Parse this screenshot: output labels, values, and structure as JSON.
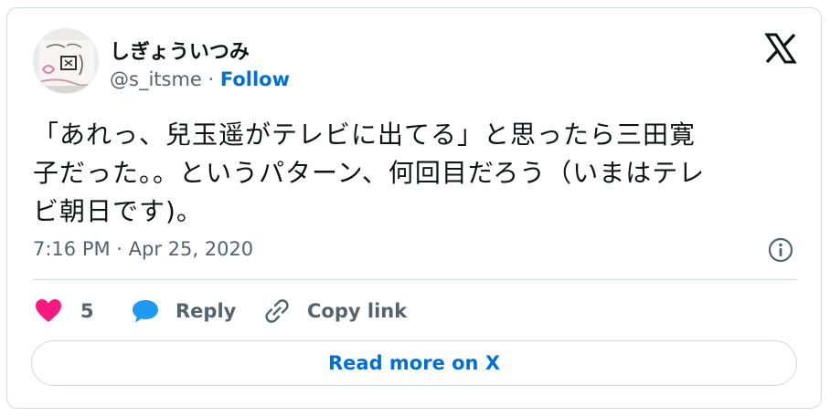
{
  "author": {
    "display_name": "しぎょういつみ",
    "handle": "@s_itsme",
    "separator": " · ",
    "follow_label": "Follow"
  },
  "tweet": {
    "text": "「あれっ、兒玉遥がテレビに出てる」と思ったら三田寛\n子だった。。というパターン、何回目だろう（いまはテレ\nビ朝日です)。",
    "timestamp": "7:16 PM · Apr 25, 2020"
  },
  "actions": {
    "like_count": "5",
    "reply_label": "Reply",
    "copy_link_label": "Copy link"
  },
  "read_more_label": "Read more on X",
  "icons": {
    "brand": "x-logo-icon",
    "info": "info-icon",
    "like": "heart-icon",
    "reply": "speech-bubble-icon",
    "copy": "link-icon"
  },
  "colors": {
    "heart": "#f91880",
    "reply_bubble": "#1d9bf0",
    "link_blue": "#006fd6",
    "muted_text": "#536471",
    "border": "#cfd9de"
  }
}
